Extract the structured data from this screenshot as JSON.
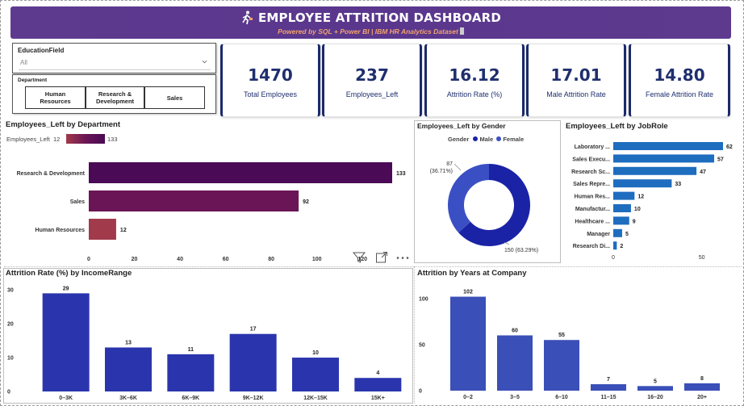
{
  "header": {
    "title": "EMPLOYEE ATTRITION DASHBOARD",
    "subtitle": "Powered by SQL + Power BI  |  IBM HR Analytics Dataset",
    "color": "#5b388d",
    "subtitle_color": "#f2a26b"
  },
  "slicers": {
    "education_field": {
      "title": "EducationField",
      "value": "All"
    },
    "department": {
      "title": "Department",
      "buttons": [
        "Human\nResources",
        "Research &\nDevelopment",
        "Sales"
      ]
    }
  },
  "kpis": [
    {
      "value": "1470",
      "label": "Total Employees"
    },
    {
      "value": "237",
      "label": "Employees_Left"
    },
    {
      "value": "16.12",
      "label": "Attrition Rate (%)"
    },
    {
      "value": "17.01",
      "label": "Male Attrition Rate"
    },
    {
      "value": "14.80",
      "label": "Female Attrition Rate"
    }
  ],
  "dept_chart": {
    "title": "Employees_Left by Department",
    "legend_label": "Employees_Left",
    "legend_min": "12",
    "legend_max": "133"
  },
  "gender_chart": {
    "title": "Employees_Left by Gender",
    "legend_title": "Gender",
    "legend_male": "Male",
    "legend_female": "Female"
  },
  "jobrole_chart": {
    "title": "Employees_Left by JobRole"
  },
  "income_chart": {
    "title": "Attrition Rate (%) by IncomeRange"
  },
  "years_chart": {
    "title": "Attrition by Years at Company"
  },
  "chart_data": [
    {
      "type": "bar",
      "title": "Employees_Left by Department",
      "orientation": "horizontal",
      "categories": [
        "Research & Development",
        "Sales",
        "Human Resources"
      ],
      "values": [
        133,
        92,
        12
      ],
      "colors": [
        "#4a0a55",
        "#6a1656",
        "#a13a4b"
      ],
      "xticks": [
        "0",
        "20",
        "40",
        "60",
        "80",
        "100",
        "120"
      ],
      "xlim": [
        0,
        133
      ]
    },
    {
      "type": "pie",
      "title": "Employees_Left by Gender",
      "donut": true,
      "slices": [
        {
          "name": "Male",
          "value": 150,
          "label": "150 (63.29%)",
          "color": "#1a23a6"
        },
        {
          "name": "Female",
          "value": 87,
          "label": "87\n(36.71%)",
          "color": "#3b4fc4"
        }
      ]
    },
    {
      "type": "bar",
      "title": "Employees_Left by JobRole",
      "orientation": "horizontal",
      "categories": [
        "Laboratory ...",
        "Sales Execu...",
        "Research Sc...",
        "Sales Repre...",
        "Human Res...",
        "Manufactur...",
        "Healthcare ...",
        "Manager",
        "Research Di..."
      ],
      "values": [
        62,
        57,
        47,
        33,
        12,
        10,
        9,
        5,
        2
      ],
      "color": "#1e6dbf",
      "xticks": [
        "0",
        "50"
      ],
      "xlim": [
        0,
        62
      ]
    },
    {
      "type": "bar",
      "title": "Attrition Rate (%) by IncomeRange",
      "categories": [
        "0–3K",
        "3K–6K",
        "6K–9K",
        "9K–12K",
        "12K–15K",
        "15K+"
      ],
      "values": [
        29,
        13,
        11,
        17,
        10,
        4
      ],
      "color": "#2a35ad",
      "yticks": [
        "0",
        "10",
        "20",
        "30"
      ],
      "ylim": [
        0,
        31
      ]
    },
    {
      "type": "bar",
      "title": "Attrition by Years at Company",
      "categories": [
        "0–2",
        "3–5",
        "6–10",
        "11–15",
        "16–20",
        "20+"
      ],
      "values": [
        102,
        60,
        55,
        7,
        5,
        8
      ],
      "color": "#3b4fb8",
      "yticks": [
        "0",
        "50",
        "100"
      ],
      "ylim": [
        0,
        106
      ]
    }
  ]
}
